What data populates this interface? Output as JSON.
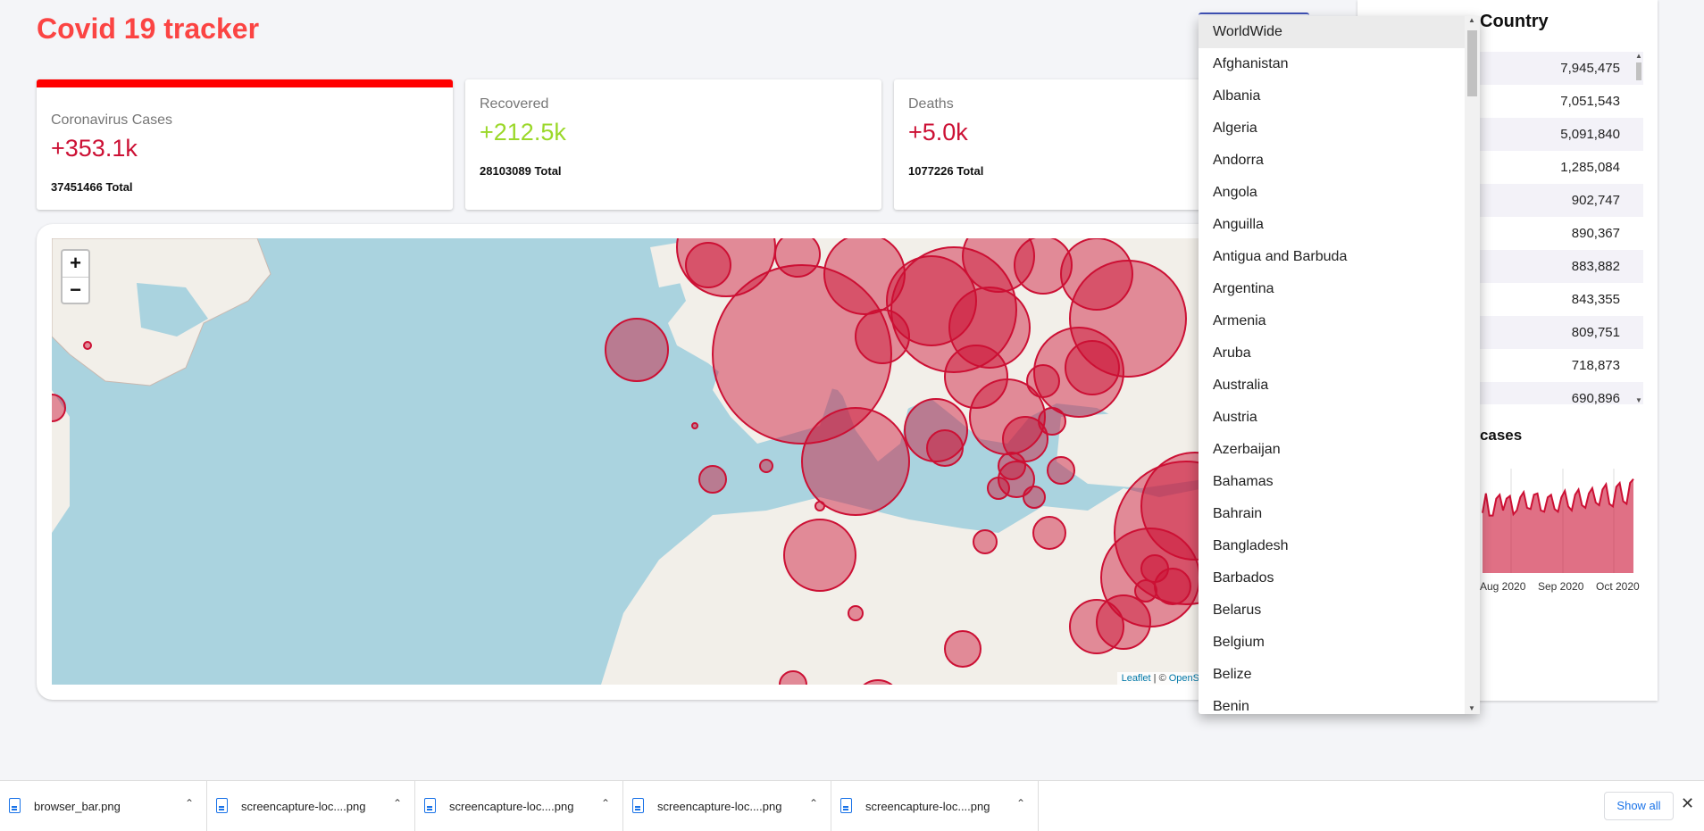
{
  "app": {
    "title": "Covid 19 tracker"
  },
  "stats": {
    "cases": {
      "label": "Coronavirus Cases",
      "value": "+353.1k",
      "total": "37451466 Total",
      "color": "#cc1034"
    },
    "recovered": {
      "label": "Recovered",
      "value": "+212.5k",
      "total": "28103089 Total",
      "color": "#7dd71d"
    },
    "deaths": {
      "label": "Deaths",
      "value": "+5.0k",
      "total": "1077226 Total",
      "color": "#cc1034"
    }
  },
  "map": {
    "zoom_in": "+",
    "zoom_out": "−",
    "attribution_leaflet": "Leaflet",
    "attribution_sep": " | © ",
    "attribution_osm": "OpenS",
    "circle_color": "#cc1034"
  },
  "country_select": {
    "selected": "WorldWide",
    "options": [
      "WorldWide",
      "Afghanistan",
      "Albania",
      "Algeria",
      "Andorra",
      "Angola",
      "Anguilla",
      "Antigua and Barbuda",
      "Argentina",
      "Armenia",
      "Aruba",
      "Australia",
      "Austria",
      "Azerbaijan",
      "Bahamas",
      "Bahrain",
      "Bangladesh",
      "Barbados",
      "Belarus",
      "Belgium",
      "Belize",
      "Benin"
    ]
  },
  "sidebar": {
    "title": "Country",
    "table_values": [
      "7,945,475",
      "7,051,543",
      "5,091,840",
      "1,285,084",
      "902,747",
      "890,367",
      "883,882",
      "843,355",
      "809,751",
      "718,873",
      "690,896"
    ],
    "chart_title": "w cases",
    "chart_x_labels": [
      "Aug 2020",
      "Sep 2020",
      "Oct 2020"
    ]
  },
  "chart_data": {
    "type": "area",
    "title": "w cases",
    "categories": [
      "Aug 2020",
      "Sep 2020",
      "Oct 2020"
    ],
    "series": [
      {
        "values": [
          230000,
          305000,
          220000,
          220000,
          285000,
          300000,
          240000,
          285000,
          295000,
          225000,
          240000,
          290000,
          310000,
          250000,
          245000,
          300000,
          305000,
          240000,
          235000,
          290000,
          300000,
          245000,
          235000,
          290000,
          315000,
          255000,
          240000,
          300000,
          320000,
          260000,
          250000,
          305000,
          325000,
          270000,
          260000,
          320000,
          340000,
          265000,
          255000,
          330000,
          345000,
          275000,
          265000,
          345000,
          360000
        ]
      }
    ],
    "color": "#cc1034"
  },
  "downloads": {
    "items": [
      "browser_bar.png",
      "screencapture-loc....png",
      "screencapture-loc....png",
      "screencapture-loc....png",
      "screencapture-loc....png"
    ],
    "show_all": "Show all",
    "close": "✕"
  }
}
